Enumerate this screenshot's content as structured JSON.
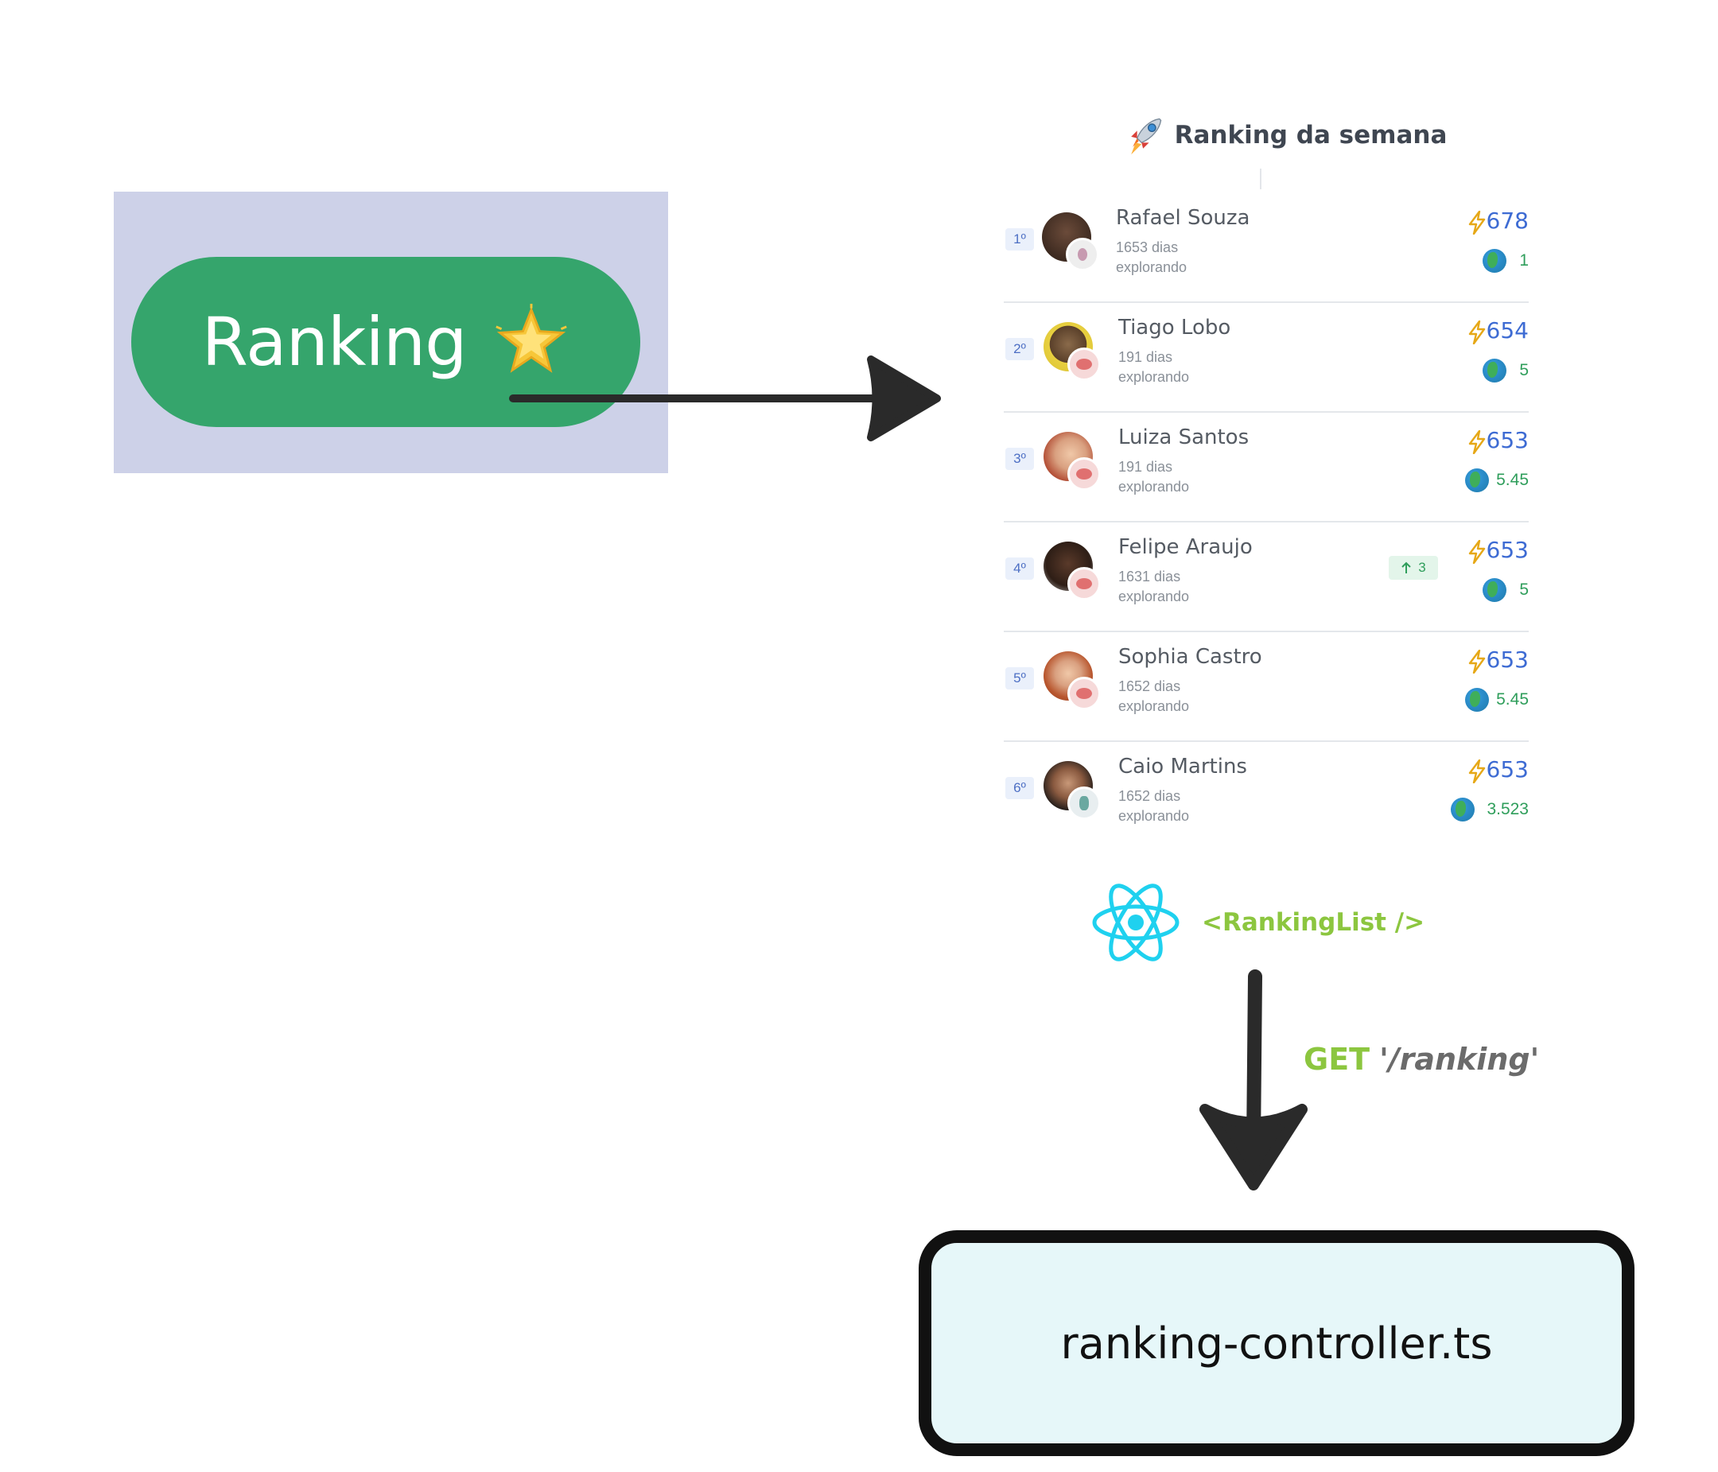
{
  "ranking_button": {
    "label": "Ranking",
    "color": "#35a56c",
    "star_icon": "sparkle-star-icon"
  },
  "ranking_list": {
    "icon": "rocket-icon",
    "title": "Ranking da semana",
    "rows": [
      {
        "position": "1º",
        "name": "Rafael Souza",
        "days": "1653 dias",
        "status": "explorando",
        "score": "678",
        "level": "1",
        "trend": ""
      },
      {
        "position": "2º",
        "name": "Tiago Lobo",
        "days": "191 dias",
        "status": "explorando",
        "score": "654",
        "level": "5",
        "trend": ""
      },
      {
        "position": "3º",
        "name": "Luiza Santos",
        "days": "191 dias",
        "status": "explorando",
        "score": "653",
        "level": "5.45",
        "trend": ""
      },
      {
        "position": "4º",
        "name": "Felipe Araujo",
        "days": "1631 dias",
        "status": "explorando",
        "score": "653",
        "level": "5",
        "trend": "3"
      },
      {
        "position": "5º",
        "name": "Sophia Castro",
        "days": "1652 dias",
        "status": "explorando",
        "score": "653",
        "level": "5.45",
        "trend": ""
      },
      {
        "position": "6º",
        "name": "Caio Martins",
        "days": "1652 dias",
        "status": "explorando",
        "score": "653",
        "level": "3.523",
        "trend": ""
      }
    ]
  },
  "component": {
    "icon": "react-logo-icon",
    "label": "<RankingList />"
  },
  "request": {
    "method": "GET",
    "path": "'/ranking'"
  },
  "controller": {
    "label": "ranking-controller.ts"
  },
  "colors": {
    "accent_green": "#8cc63f",
    "score_blue": "#3d6bd3",
    "level_green": "#2f9e5b",
    "react_cyan": "#1fd1ef"
  }
}
